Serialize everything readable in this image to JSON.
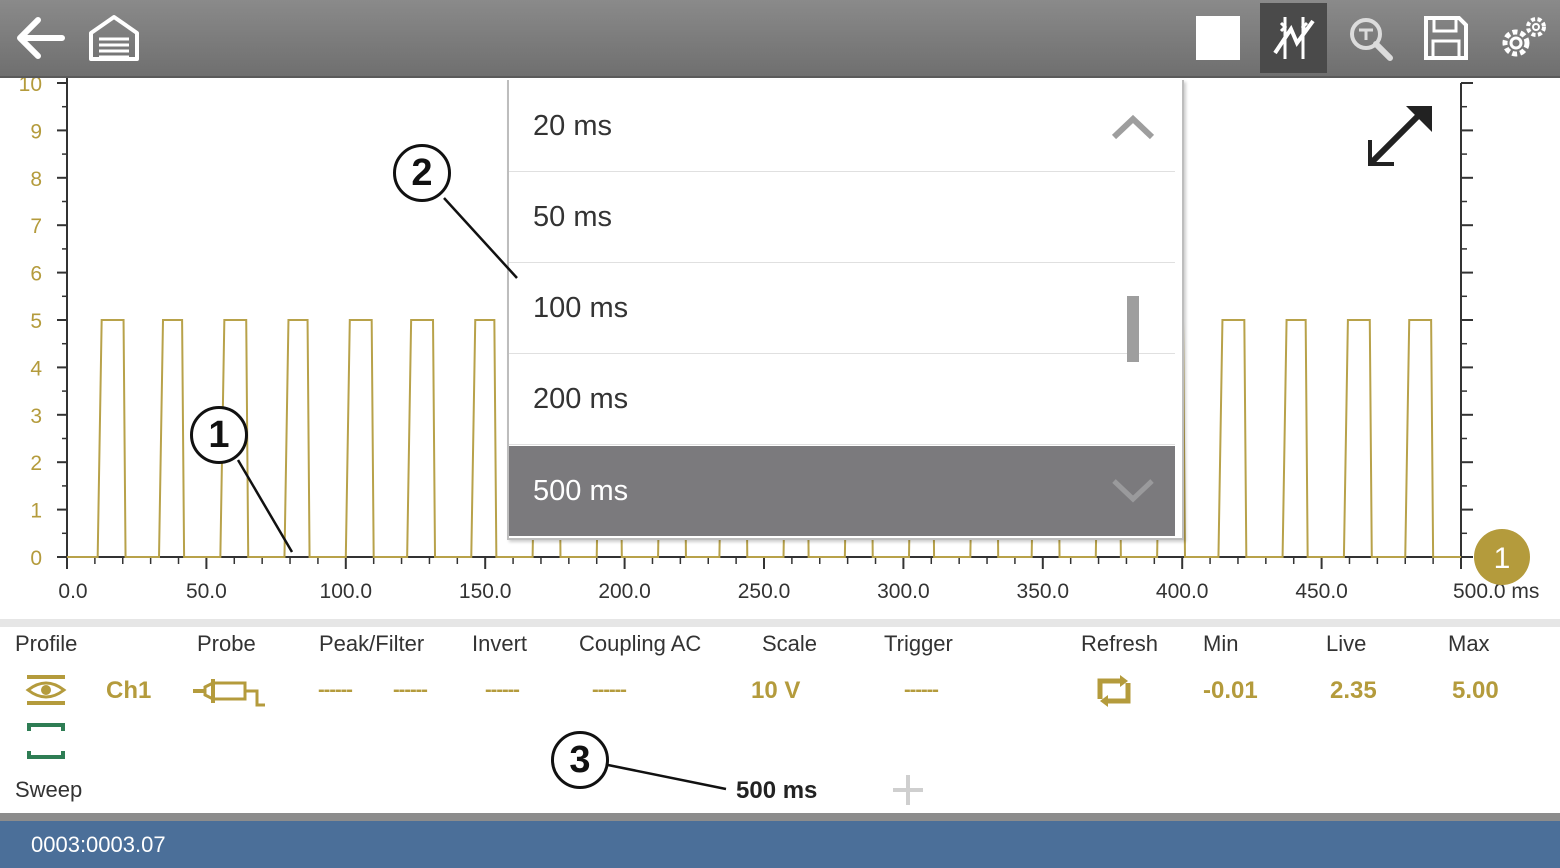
{
  "toolbar": {
    "icons": [
      "back-arrow-icon",
      "garage-home-icon",
      "stop-square-icon",
      "cursors-icon",
      "zoom-icon",
      "save-icon",
      "settings-gears-icon"
    ]
  },
  "chart_data": {
    "type": "line",
    "x": {
      "min": 0,
      "max": 500,
      "ticks": [
        0,
        50,
        100,
        150,
        200,
        250,
        300,
        350,
        400,
        450,
        500
      ],
      "tick_labels": [
        "0.0",
        "50.0",
        "100.0",
        "150.0",
        "200.0",
        "250.0",
        "300.0",
        "350.0",
        "400.0",
        "450.0",
        "500.0 ms"
      ]
    },
    "y": {
      "min": 0,
      "max": 10,
      "ticks": [
        0,
        1,
        2,
        3,
        4,
        5,
        6,
        7,
        8,
        9,
        10
      ],
      "tick_labels": [
        "0",
        "1",
        "2",
        "3",
        "4",
        "5",
        "6",
        "7",
        "8",
        "9",
        "10"
      ]
    },
    "series": [
      {
        "color": "#b8a24a",
        "low": 0,
        "high": 5,
        "high_pulses_ms": [
          [
            11,
            21
          ],
          [
            33,
            42
          ],
          [
            55,
            65
          ],
          [
            78,
            87
          ],
          [
            100,
            110
          ],
          [
            122,
            132
          ],
          [
            145,
            154
          ],
          [
            167,
            177
          ],
          [
            190,
            199
          ],
          [
            212,
            222
          ],
          [
            234,
            244
          ],
          [
            257,
            266
          ],
          [
            279,
            289
          ],
          [
            302,
            311
          ],
          [
            324,
            334
          ],
          [
            346,
            356
          ],
          [
            369,
            378
          ],
          [
            391,
            401
          ],
          [
            413,
            423
          ],
          [
            436,
            445
          ],
          [
            458,
            468
          ],
          [
            480,
            490
          ]
        ]
      }
    ],
    "channel_marker": "1"
  },
  "dropdown": {
    "items": [
      "20 ms",
      "50 ms",
      "100 ms",
      "200 ms",
      "500 ms"
    ],
    "selected": "500 ms"
  },
  "panel": {
    "headers": {
      "profile": "Profile",
      "probe": "Probe",
      "peak_filter": "Peak/Filter",
      "invert": "Invert",
      "coupling": "Coupling AC",
      "scale": "Scale",
      "trigger": "Trigger",
      "refresh": "Refresh",
      "min": "Min",
      "live": "Live",
      "max": "Max"
    },
    "channel": "Ch1",
    "peak_value": "------",
    "filter_value": "------",
    "invert_value": "------",
    "coupling_value": "------",
    "scale_value": "10 V",
    "trigger_value": "------",
    "min_value": "-0.01",
    "live_value": "2.35",
    "max_value": "5.00",
    "sweep_label": "Sweep",
    "sweep_value": "500 ms"
  },
  "status": {
    "text": "0003:0003.07"
  },
  "callouts": [
    "1",
    "2",
    "3"
  ],
  "colors": {
    "trace": "#b8a24a",
    "accent": "#b49b3c",
    "statusbar": "#4b6f99",
    "selected_item": "#7b7a7d"
  }
}
